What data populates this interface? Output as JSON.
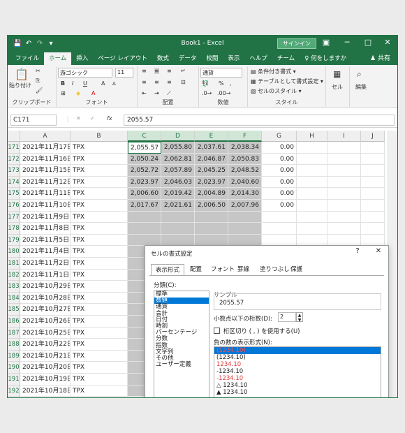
{
  "titlebar": {
    "title": "Book1  -  Excel",
    "signin": "サインイン",
    "save_icon": "save-icon",
    "undo_icon": "undo-icon",
    "redo_icon": "redo-icon",
    "qat_icon": "customize-icon",
    "ribbon_display_icon": "ribbon-display-icon",
    "minimize": "─",
    "maximize": "□",
    "close": "✕"
  },
  "ribbon_tabs": [
    "ファイル",
    "ホーム",
    "挿入",
    "ページ レイアウト",
    "数式",
    "データ",
    "校閲",
    "表示",
    "ヘルプ",
    "チーム",
    "何をしますか"
  ],
  "share": "共有",
  "ribbon": {
    "clipboard": {
      "label": "クリップボード",
      "paste": "貼り付け"
    },
    "font": {
      "label": "フォント",
      "name": "游ゴシック",
      "size": "11",
      "bold": "B",
      "italic": "I",
      "underline": "U",
      "grow": "A",
      "shrink": "A"
    },
    "align": {
      "label": "配置"
    },
    "number": {
      "label": "数値",
      "format": "通貨",
      "percent": "%",
      "comma": ","
    },
    "style": {
      "label": "スタイル",
      "conditional": "条件付き書式",
      "table": "テーブルとして書式設定",
      "cell": "セルのスタイル"
    },
    "cells": {
      "label": "セル"
    },
    "edit": {
      "label": "編集"
    }
  },
  "formula_bar": {
    "namebox": "C171",
    "value": "2055.57",
    "fx": "fx"
  },
  "columns": [
    "A",
    "B",
    "C",
    "D",
    "E",
    "F",
    "G",
    "H",
    "I",
    "J"
  ],
  "rows": [
    {
      "n": "171",
      "a": "2021年11月17日",
      "b": "TPX",
      "c": "2,055.57",
      "d": "2,055.80",
      "e": "2,037.61",
      "f": "2,038.34",
      "g": "0.00"
    },
    {
      "n": "172",
      "a": "2021年11月16日",
      "b": "TPX",
      "c": "2,050.24",
      "d": "2,062.81",
      "e": "2,046.87",
      "f": "2,050.83",
      "g": "0.00"
    },
    {
      "n": "173",
      "a": "2021年11月15日",
      "b": "TPX",
      "c": "2,052.72",
      "d": "2,057.89",
      "e": "2,045.25",
      "f": "2,048.52",
      "g": "0.00"
    },
    {
      "n": "174",
      "a": "2021年11月12日",
      "b": "TPX",
      "c": "2,023.97",
      "d": "2,046.03",
      "e": "2,023.97",
      "f": "2,040.60",
      "g": "0.00"
    },
    {
      "n": "175",
      "a": "2021年11月11日",
      "b": "TPX",
      "c": "2,006.60",
      "d": "2,019.42",
      "e": "2,004.89",
      "f": "2,014.30",
      "g": "0.00"
    },
    {
      "n": "176",
      "a": "2021年11月10日",
      "b": "TPX",
      "c": "2,017.67",
      "d": "2,021.61",
      "e": "2,006.50",
      "f": "2,007.96",
      "g": "0.00"
    },
    {
      "n": "177",
      "a": "2021年11月9日",
      "b": "TPX",
      "c": "",
      "d": "",
      "e": "",
      "f": "",
      "g": ""
    },
    {
      "n": "178",
      "a": "2021年11月8日",
      "b": "TPX",
      "c": "",
      "d": "",
      "e": "",
      "f": "",
      "g": ""
    },
    {
      "n": "179",
      "a": "2021年11月5日",
      "b": "TPX",
      "c": "",
      "d": "",
      "e": "",
      "f": "",
      "g": ""
    },
    {
      "n": "180",
      "a": "2021年11月4日",
      "b": "TPX",
      "c": "",
      "d": "",
      "e": "",
      "f": "",
      "g": ""
    },
    {
      "n": "181",
      "a": "2021年11月2日",
      "b": "TPX",
      "c": "",
      "d": "",
      "e": "",
      "f": "",
      "g": ""
    },
    {
      "n": "182",
      "a": "2021年11月1日",
      "b": "TPX",
      "c": "",
      "d": "",
      "e": "",
      "f": "",
      "g": ""
    },
    {
      "n": "183",
      "a": "2021年10月29日",
      "b": "TPX",
      "c": "",
      "d": "",
      "e": "",
      "f": "",
      "g": ""
    },
    {
      "n": "184",
      "a": "2021年10月28日",
      "b": "TPX",
      "c": "",
      "d": "",
      "e": "",
      "f": "",
      "g": ""
    },
    {
      "n": "185",
      "a": "2021年10月27日",
      "b": "TPX",
      "c": "",
      "d": "",
      "e": "",
      "f": "",
      "g": ""
    },
    {
      "n": "186",
      "a": "2021年10月26日",
      "b": "TPX",
      "c": "",
      "d": "",
      "e": "",
      "f": "",
      "g": ""
    },
    {
      "n": "187",
      "a": "2021年10月25日",
      "b": "TPX",
      "c": "",
      "d": "",
      "e": "",
      "f": "",
      "g": ""
    },
    {
      "n": "188",
      "a": "2021年10月22日",
      "b": "TPX",
      "c": "",
      "d": "",
      "e": "",
      "f": "",
      "g": ""
    },
    {
      "n": "189",
      "a": "2021年10月21日",
      "b": "TPX",
      "c": "",
      "d": "",
      "e": "",
      "f": "",
      "g": ""
    },
    {
      "n": "190",
      "a": "2021年10月20日",
      "b": "TPX",
      "c": "",
      "d": "",
      "e": "",
      "f": "",
      "g": ""
    },
    {
      "n": "191",
      "a": "2021年10月19日",
      "b": "TPX",
      "c": "",
      "d": "",
      "e": "",
      "f": "",
      "g": ""
    },
    {
      "n": "192",
      "a": "2021年10月18日",
      "b": "TPX",
      "c": "",
      "d": "",
      "e": "",
      "f": "",
      "g": ""
    }
  ],
  "dialog": {
    "title": "セルの書式設定",
    "help": "?",
    "close": "✕",
    "tabs": [
      "表示形式",
      "配置",
      "フォント",
      "罫線",
      "塗りつぶし",
      "保護"
    ],
    "category_label": "分類(C):",
    "categories": [
      "標準",
      "数値",
      "通貨",
      "会計",
      "日付",
      "時刻",
      "パーセンテージ",
      "分数",
      "指数",
      "文字列",
      "その他",
      "ユーザー定義"
    ],
    "sample_label": "サンプル",
    "sample_value": "2055.57",
    "decimals_label": "小数点以下の桁数(D):",
    "decimals_value": "2",
    "separator_label": "桁区切り ( , ) を使用する(U)",
    "negative_label": "負の数の表示形式(N):",
    "negative_formats": [
      "(1234.10)",
      "(1234.10)",
      "1234.10",
      "-1234.10",
      "-1234.10",
      "△ 1234.10",
      "▲ 1234.10"
    ]
  }
}
